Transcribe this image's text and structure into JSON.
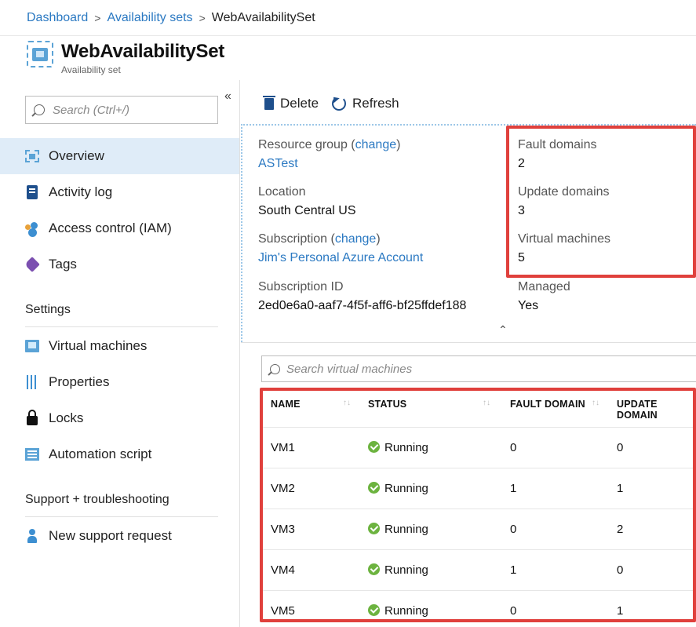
{
  "breadcrumb": {
    "items": [
      "Dashboard",
      "Availability sets"
    ],
    "current": "WebAvailabilitySet",
    "separator": ">"
  },
  "header": {
    "title": "WebAvailabilitySet",
    "subtitle": "Availability set"
  },
  "sidebar": {
    "collapse_glyph": "«",
    "search_placeholder": "Search (Ctrl+/)",
    "items": [
      {
        "label": "Overview",
        "icon": "overview-icon",
        "active": true
      },
      {
        "label": "Activity log",
        "icon": "activity-log-icon"
      },
      {
        "label": "Access control (IAM)",
        "icon": "iam-icon"
      },
      {
        "label": "Tags",
        "icon": "tag-icon"
      }
    ],
    "settings_header": "Settings",
    "settings_items": [
      {
        "label": "Virtual machines",
        "icon": "vm-icon"
      },
      {
        "label": "Properties",
        "icon": "properties-icon"
      },
      {
        "label": "Locks",
        "icon": "lock-icon"
      },
      {
        "label": "Automation script",
        "icon": "script-icon"
      }
    ],
    "support_header": "Support + troubleshooting",
    "support_items": [
      {
        "label": "New support request",
        "icon": "support-icon"
      }
    ]
  },
  "toolbar": {
    "delete_label": "Delete",
    "refresh_label": "Refresh"
  },
  "essentials": {
    "resource_group_label": "Resource group",
    "change_label": "change",
    "resource_group_value": "ASTest",
    "location_label": "Location",
    "location_value": "South Central US",
    "subscription_label": "Subscription",
    "subscription_value": "Jim's Personal Azure Account",
    "subscription_id_label": "Subscription ID",
    "subscription_id_value": "2ed0e6a0-aaf7-4f5f-aff6-bf25ffdef188",
    "fault_domains_label": "Fault domains",
    "fault_domains_value": "2",
    "update_domains_label": "Update domains",
    "update_domains_value": "3",
    "virtual_machines_label": "Virtual machines",
    "virtual_machines_value": "5",
    "managed_label": "Managed",
    "managed_value": "Yes",
    "collapse_glyph": "⌃"
  },
  "vm_search": {
    "placeholder": "Search virtual machines"
  },
  "vm_table": {
    "columns": [
      "NAME",
      "STATUS",
      "FAULT DOMAIN",
      "UPDATE DOMAIN"
    ],
    "rows": [
      {
        "name": "VM1",
        "status": "Running",
        "fault_domain": "0",
        "update_domain": "0"
      },
      {
        "name": "VM2",
        "status": "Running",
        "fault_domain": "1",
        "update_domain": "1"
      },
      {
        "name": "VM3",
        "status": "Running",
        "fault_domain": "0",
        "update_domain": "2"
      },
      {
        "name": "VM4",
        "status": "Running",
        "fault_domain": "1",
        "update_domain": "0"
      },
      {
        "name": "VM5",
        "status": "Running",
        "fault_domain": "0",
        "update_domain": "1"
      }
    ]
  },
  "colors": {
    "link": "#2b79c2",
    "highlight_box": "#e0403c",
    "status_running": "#6cb33f",
    "active_nav": "#dfecf8"
  }
}
